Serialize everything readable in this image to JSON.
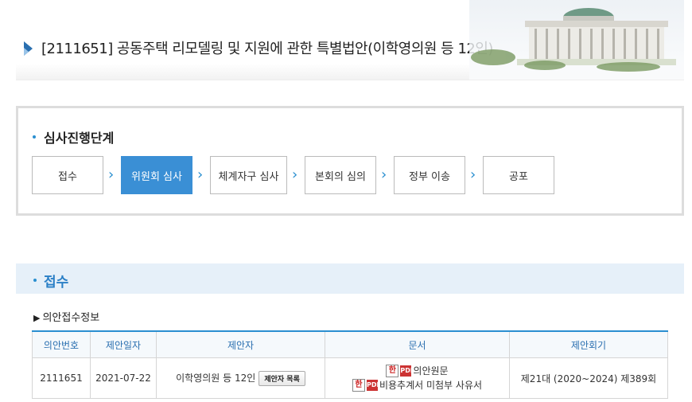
{
  "header": {
    "title": "[2111651] 공동주택 리모델링 및 지원에 관한 특별법안(이학영의원 등 12인)"
  },
  "stages": {
    "title": "심사진행단계",
    "steps": [
      "접수",
      "위원회 심사",
      "체계자구 심사",
      "본회의 심의",
      "정부 이송",
      "공포"
    ],
    "active_index": 1
  },
  "section": {
    "title": "접수"
  },
  "receipt": {
    "subtitle": "의안접수정보",
    "columns": [
      "의안번호",
      "제안일자",
      "제안자",
      "문서",
      "제안회기"
    ],
    "row": {
      "bill_no": "2111651",
      "date": "2021-07-22",
      "proposer": "이학영의원 등 12인",
      "proposer_button": "제안자 목록",
      "docs": [
        "의안원문",
        "비용추계서 미첨부 사유서"
      ],
      "session": "제21대 (2020~2024) 제389회"
    }
  },
  "colors": {
    "accent": "#2a8fd0",
    "active_step": "#3a8fd5"
  },
  "icons": {
    "doc_hwp": "hwp-icon",
    "doc_pdf": "pdf-icon"
  }
}
